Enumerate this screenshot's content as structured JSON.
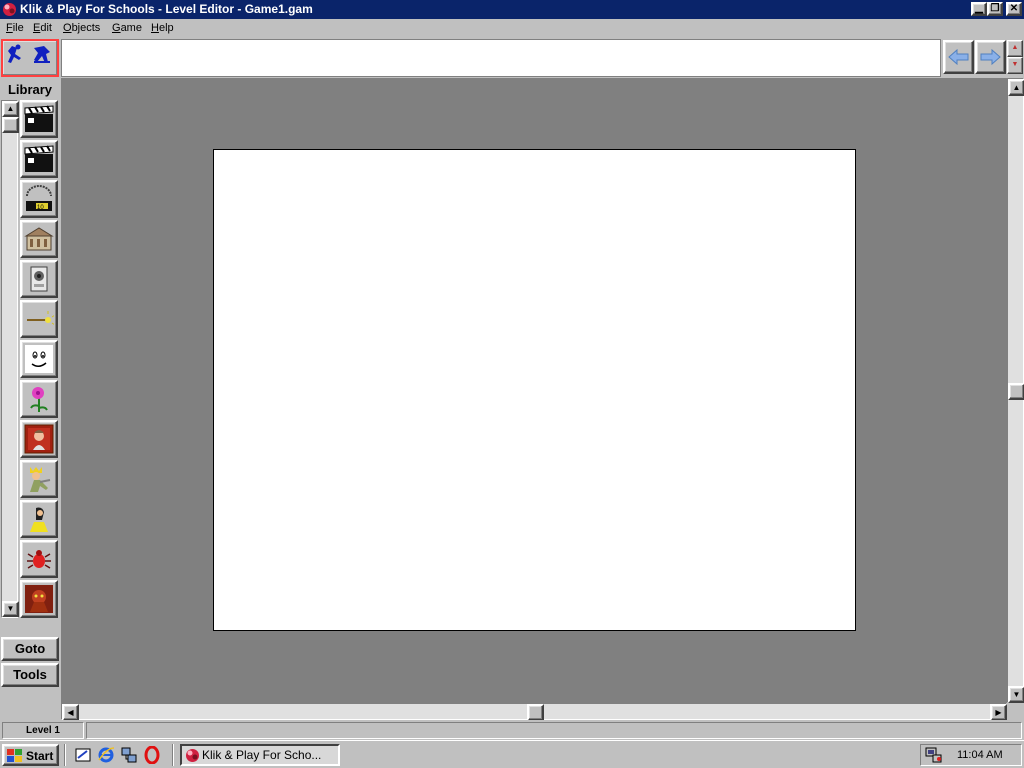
{
  "window": {
    "title": "Klik & Play For Schools - Level Editor - Game1.gam",
    "minimize_icon": "minimize-icon",
    "restore_icon": "restore-icon",
    "close_icon": "close-icon"
  },
  "menu": {
    "items": [
      {
        "label": "File"
      },
      {
        "label": "Edit"
      },
      {
        "label": "Objects"
      },
      {
        "label": "Game"
      },
      {
        "label": "Help"
      }
    ]
  },
  "library": {
    "label": "Library",
    "items": [
      {
        "name": "clapperboard-1",
        "icon": "clapperboard-icon"
      },
      {
        "name": "clapperboard-2",
        "icon": "clapperboard-icon"
      },
      {
        "name": "score-counter",
        "icon": "counter-icon"
      },
      {
        "name": "building",
        "icon": "building-icon"
      },
      {
        "name": "speaker-device",
        "icon": "speaker-icon"
      },
      {
        "name": "magic-wand",
        "icon": "wand-icon"
      },
      {
        "name": "smiley-face",
        "icon": "face-icon"
      },
      {
        "name": "flower",
        "icon": "flower-icon"
      },
      {
        "name": "portrait-woman",
        "icon": "portrait-icon"
      },
      {
        "name": "king-character",
        "icon": "king-icon"
      },
      {
        "name": "yellow-person",
        "icon": "person-icon"
      },
      {
        "name": "red-bug",
        "icon": "bug-icon"
      },
      {
        "name": "red-creature",
        "icon": "creature-icon"
      }
    ]
  },
  "side_buttons": {
    "goto": "Goto",
    "tools": "Tools"
  },
  "status": {
    "level": "Level 1"
  },
  "taskbar": {
    "start": "Start",
    "task_label": "Klik & Play For Scho...",
    "clock": "11:04 AM"
  },
  "colors": {
    "titlebar": "#0a246a",
    "workspace": "#808080",
    "face": "#c0c0c0"
  }
}
